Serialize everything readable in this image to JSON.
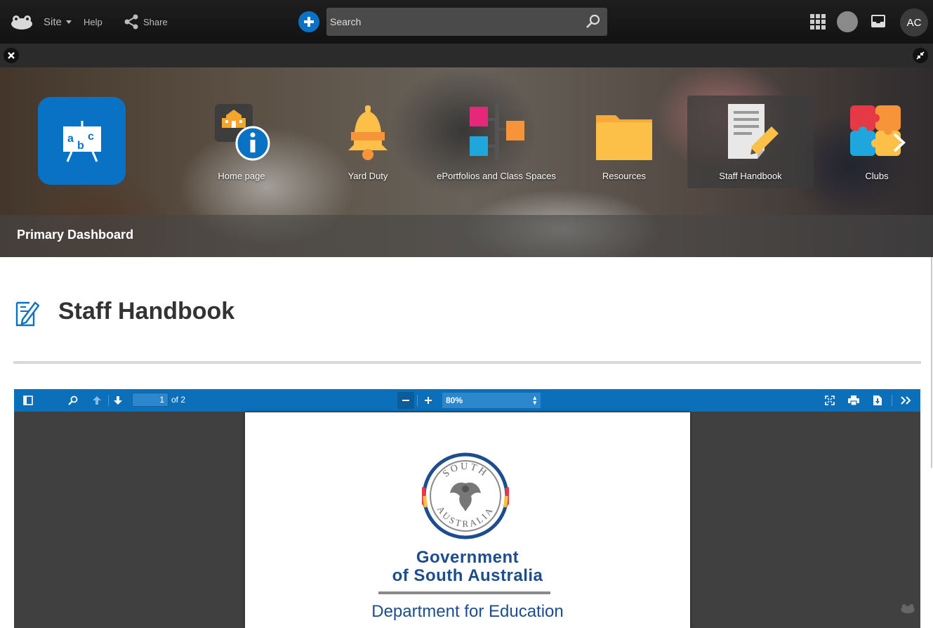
{
  "topbar": {
    "site_label": "Site",
    "help_label": "Help",
    "share_label": "Share",
    "search_placeholder": "Search",
    "avatar_initials": "AC"
  },
  "banner": {
    "title": "Primary Dashboard",
    "tiles": [
      {
        "label": "Home page",
        "icon": "school-info-icon"
      },
      {
        "label": "Yard Duty",
        "icon": "bell-icon"
      },
      {
        "label": "ePortfolios and Class Spaces",
        "icon": "blocks-icon"
      },
      {
        "label": "Resources",
        "icon": "folder-icon"
      },
      {
        "label": "Staff Handbook",
        "icon": "document-pencil-icon",
        "active": true
      },
      {
        "label": "Clubs",
        "icon": "puzzle-icon"
      }
    ]
  },
  "page": {
    "title": "Staff Handbook"
  },
  "pdf": {
    "current_page": "1",
    "page_count": "of 2",
    "zoom": "80%",
    "doc_text": {
      "seal_top": "SOUTH",
      "seal_bottom": "AUSTRALIA",
      "line1": "Government",
      "line2": "of South Australia",
      "dept": "Department for Education"
    }
  },
  "colors": {
    "accent": "#0a72c4",
    "toolbar": "#0b6fba",
    "gov_blue": "#1d4d8f"
  }
}
